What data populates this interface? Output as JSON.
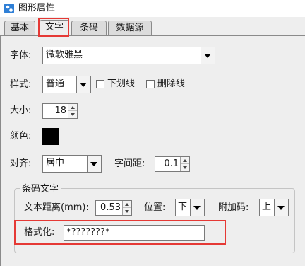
{
  "window": {
    "title": "图形属性"
  },
  "tabs": [
    {
      "label": "基本",
      "active": false
    },
    {
      "label": "文字",
      "active": true
    },
    {
      "label": "条码",
      "active": false
    },
    {
      "label": "数据源",
      "active": false
    }
  ],
  "font": {
    "label": "字体:",
    "value": "微软雅黑"
  },
  "style": {
    "label": "样式:",
    "value": "普通",
    "underline_label": "下划线",
    "underline_checked": false,
    "strike_label": "删除线",
    "strike_checked": false
  },
  "size": {
    "label": "大小:",
    "value": "18"
  },
  "color": {
    "label": "颜色:",
    "value": "#000000"
  },
  "align": {
    "label": "对齐:",
    "value": "居中",
    "spacing_label": "字间距:",
    "spacing_value": "0.1"
  },
  "barcode_text": {
    "group_title": "条码文字",
    "distance_label": "文本距离(mm):",
    "distance_value": "0.53",
    "position_label": "位置:",
    "position_value": "下",
    "addon_label": "附加码:",
    "addon_value": "上",
    "format_label": "格式化:",
    "format_value": "*???????*"
  },
  "colors": {
    "highlight": "#e53935"
  }
}
